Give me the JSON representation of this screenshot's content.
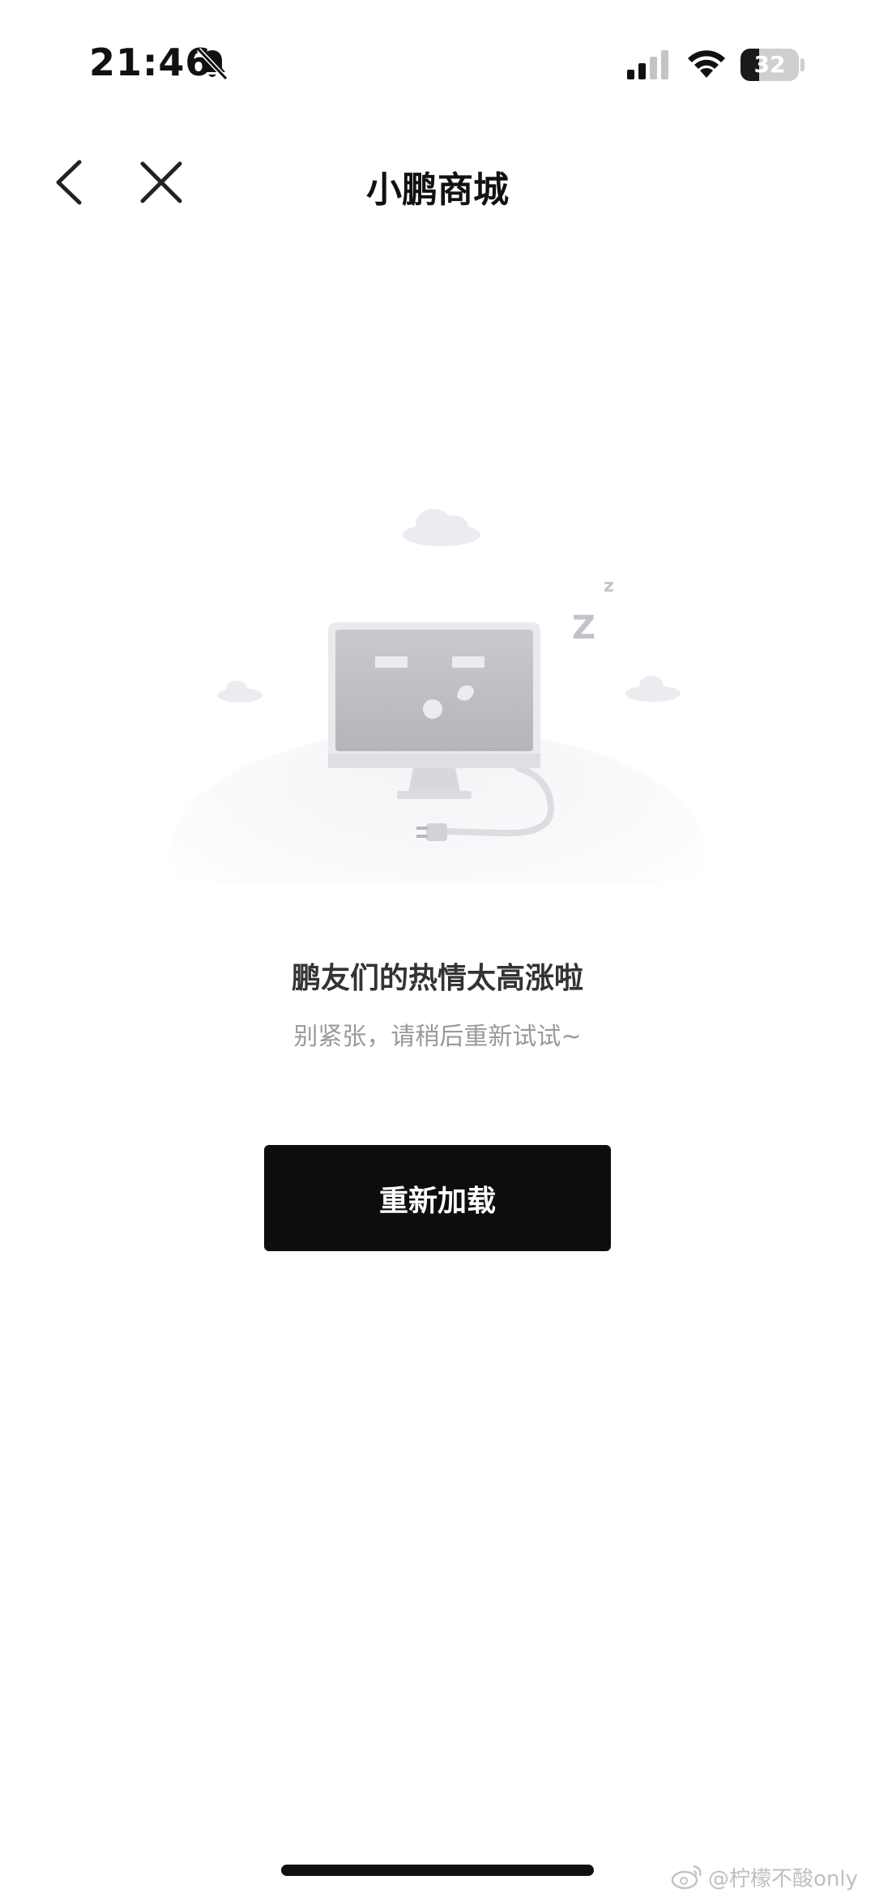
{
  "status_bar": {
    "time": "21:46",
    "battery_level": "32",
    "icons": [
      "bell-slash-icon",
      "signal-icon",
      "wifi-icon",
      "battery-icon"
    ]
  },
  "nav": {
    "title": "小鹏商城",
    "icons": [
      "back-chevron-icon",
      "close-icon"
    ]
  },
  "error": {
    "title": "鹏友们的热情太高涨啦",
    "subtitle": "别紧张，请稍后重新试试~",
    "illustration_text": "z Z"
  },
  "actions": {
    "reload_label": "重新加载"
  },
  "watermark": {
    "text": "@柠檬不酸only"
  },
  "colors": {
    "button_bg": "#0d0d0d",
    "button_text": "#ffffff",
    "subtitle": "#9a9a9a"
  }
}
